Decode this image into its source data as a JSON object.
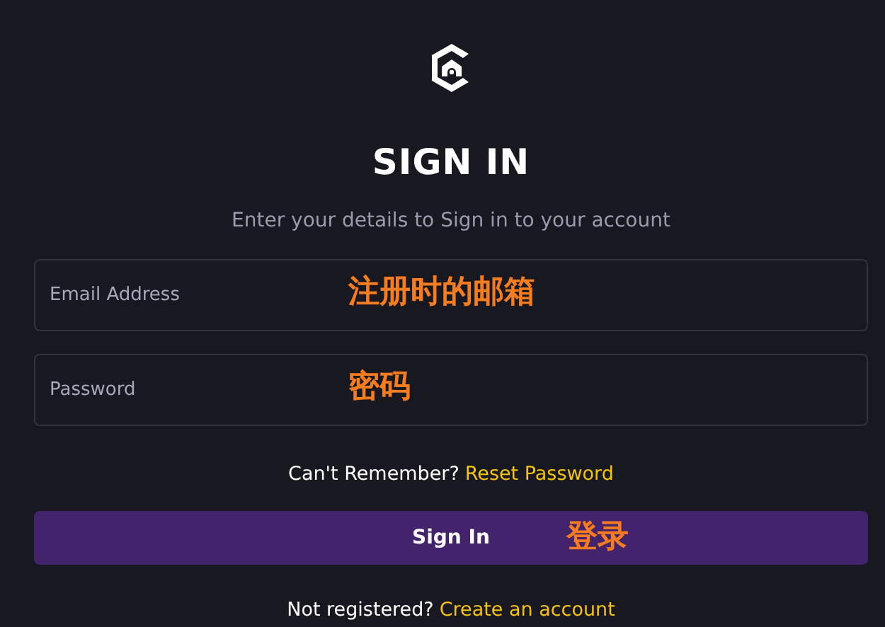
{
  "heading": "SIGN IN",
  "subtitle": "Enter your details to Sign in to your account",
  "fields": [
    {
      "placeholder": "Email Address",
      "annotation": "注册时的邮箱"
    },
    {
      "placeholder": "Password",
      "annotation": "密码"
    }
  ],
  "reset_prompt": {
    "text": "Can't Remember?",
    "link": "Reset Password"
  },
  "submit": {
    "label": "Sign In",
    "annotation": "登录"
  },
  "register_prompt": {
    "text": "Not registered?",
    "link": "Create an account"
  }
}
